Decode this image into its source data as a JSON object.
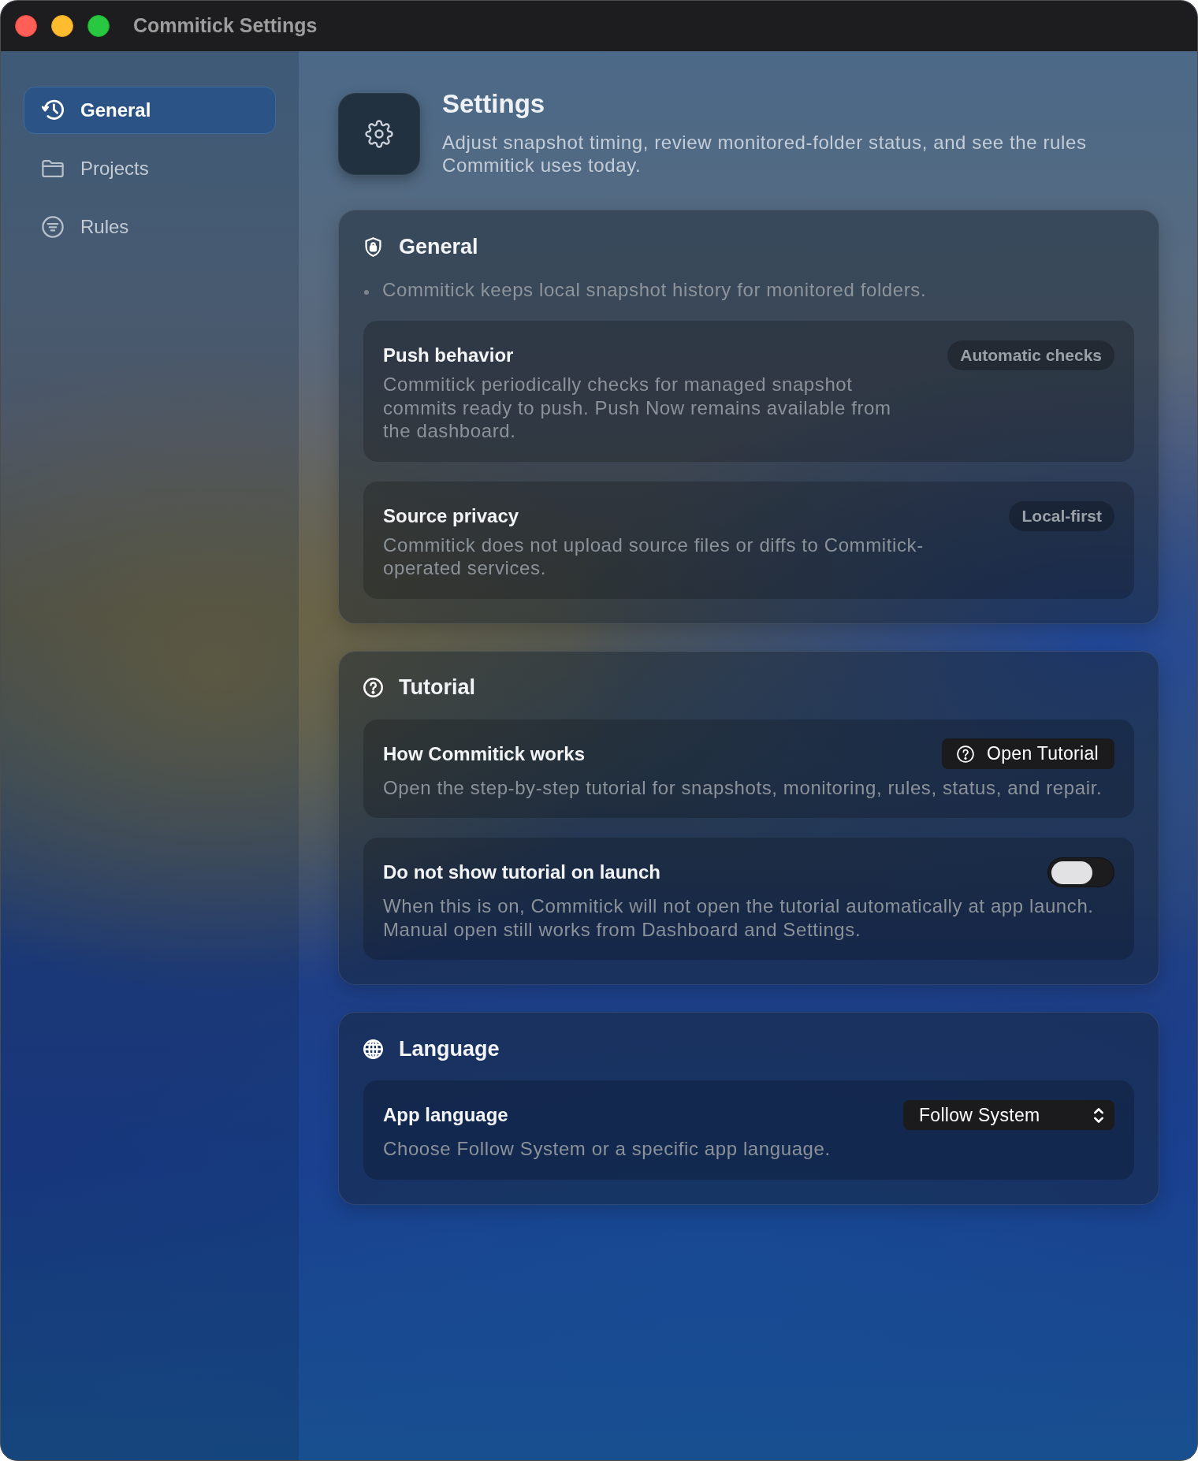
{
  "window": {
    "title": "Commitick Settings"
  },
  "sidebar": {
    "items": [
      {
        "label": "General",
        "selected": true
      },
      {
        "label": "Projects",
        "selected": false
      },
      {
        "label": "Rules",
        "selected": false
      }
    ]
  },
  "header": {
    "title": "Settings",
    "description": "Adjust snapshot timing, review monitored-folder status, and see the rules Commitick uses today."
  },
  "sections": [
    {
      "title": "General",
      "note": "Commitick keeps local snapshot history for monitored folders.",
      "rows": [
        {
          "kind": "badge",
          "title": "Push behavior",
          "description": "Commitick periodically checks for managed snapshot commits ready to push. Push Now remains available from the dashboard.",
          "badge": "Automatic checks"
        },
        {
          "kind": "badge",
          "title": "Source privacy",
          "description": "Commitick does not upload source files or diffs to Commitick-operated services.",
          "badge": "Local-first"
        }
      ]
    },
    {
      "title": "Tutorial",
      "rows": [
        {
          "kind": "button",
          "title": "How Commitick works",
          "description": "Open the step-by-step tutorial for snapshots, monitoring, rules, status, and repair.",
          "button": "Open Tutorial"
        },
        {
          "kind": "toggle",
          "title": "Do not show tutorial on launch",
          "description": "When this is on, Commitick will not open the tutorial automatically at app launch. Manual open still works from Dashboard and Settings.",
          "on": false
        }
      ]
    },
    {
      "title": "Language",
      "rows": [
        {
          "kind": "select",
          "title": "App language",
          "description": "Choose Follow System or a specific app language.",
          "value": "Follow System"
        }
      ]
    }
  ]
}
